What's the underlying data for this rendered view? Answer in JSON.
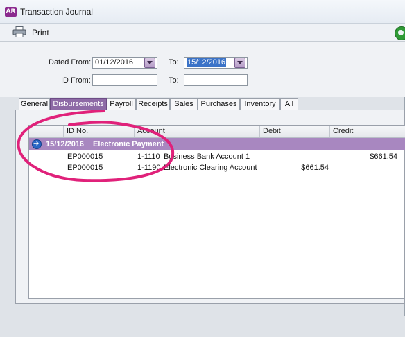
{
  "window": {
    "title": "Transaction Journal",
    "app_badge": "AR"
  },
  "toolbar": {
    "print_label": "Print"
  },
  "filters": {
    "dated_from_label": "Dated From:",
    "dated_from_value": "01/12/2016",
    "to_label": "To:",
    "to_value": "15/12/2016",
    "id_from_label": "ID From:",
    "id_from_value": "",
    "id_to_label": "To:",
    "id_to_value": ""
  },
  "tabs": [
    {
      "label": "General",
      "active": false
    },
    {
      "label": "Disbursements",
      "active": true
    },
    {
      "label": "Payroll",
      "active": false
    },
    {
      "label": "Receipts",
      "active": false
    },
    {
      "label": "Sales",
      "active": false
    },
    {
      "label": "Purchases",
      "active": false
    },
    {
      "label": "Inventory",
      "active": false
    },
    {
      "label": "All",
      "active": false
    }
  ],
  "table": {
    "columns": [
      "ID No.",
      "Account",
      "Debit",
      "Credit"
    ],
    "group": {
      "date": "15/12/2016",
      "description": "Electronic Payment"
    },
    "rows": [
      {
        "id": "EP000015",
        "account_no": "1-1110",
        "account_name": "Business Bank Account 1",
        "debit": "",
        "credit": "$661.54"
      },
      {
        "id": "EP000015",
        "account_no": "1-1190",
        "account_name": "Electronic Clearing Account",
        "debit": "$661.54",
        "credit": ""
      }
    ]
  },
  "colors": {
    "accent_purple": "#8e6aa6",
    "group_row": "#a887c0",
    "highlight_circle": "#e0217a"
  }
}
